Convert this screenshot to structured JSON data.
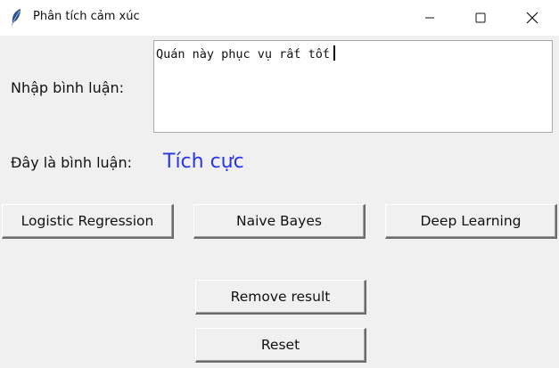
{
  "window": {
    "title": "Phân tích cảm xúc"
  },
  "form": {
    "input_label": "Nhập bình luận:",
    "input_value": "Quán này phục vụ rất tốt",
    "result_label": "Đây là bình luận:",
    "result_value": "Tích cực",
    "result_color": "#2a35e8"
  },
  "buttons": {
    "logistic": "Logistic Regression",
    "naive_bayes": "Naive Bayes",
    "deep_learning": "Deep Learning",
    "remove_result": "Remove result",
    "reset": "Reset"
  },
  "icons": {
    "app": "feather-icon",
    "minimize": "minimize-icon",
    "maximize": "maximize-icon",
    "close": "close-icon"
  }
}
